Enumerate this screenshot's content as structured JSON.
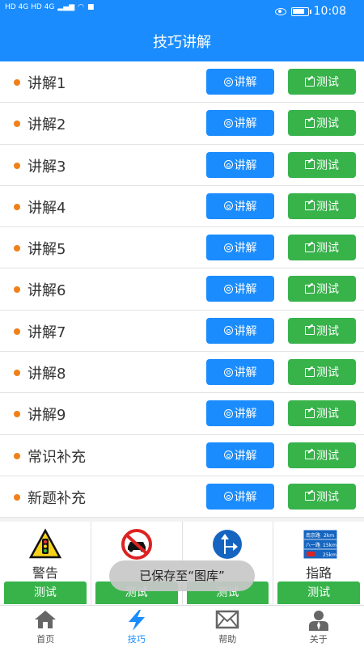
{
  "status_bar": {
    "left_text": "HD 4G HD 4G",
    "time": "10:08",
    "battery_level": 0.85
  },
  "header": {
    "title": "技巧讲解"
  },
  "list": {
    "explain_label": "讲解",
    "test_label": "测试",
    "items": [
      {
        "label": "讲解1"
      },
      {
        "label": "讲解2"
      },
      {
        "label": "讲解3"
      },
      {
        "label": "讲解4"
      },
      {
        "label": "讲解5"
      },
      {
        "label": "讲解6"
      },
      {
        "label": "讲解7"
      },
      {
        "label": "讲解8"
      },
      {
        "label": "讲解9"
      },
      {
        "label": "常识补充"
      },
      {
        "label": "新题补充"
      }
    ]
  },
  "signs": [
    {
      "label": "警告",
      "button": "测试",
      "icon": "warning-traffic-light-icon"
    },
    {
      "label": "",
      "button": "测试",
      "icon": "prohibition-no-car-icon"
    },
    {
      "label": "",
      "button": "测试",
      "icon": "mandatory-direction-icon"
    },
    {
      "label": "指路",
      "button": "测试",
      "icon": "guide-road-sign-icon"
    }
  ],
  "guide_sign_text": {
    "row1_name": "南京路",
    "row1_dist": "2km",
    "row2_name": "八一路",
    "row2_dist": "15km",
    "row3_dist": "25km"
  },
  "toast": {
    "text": "已保存至“图库”"
  },
  "tabbar": {
    "items": [
      {
        "label": "首页",
        "icon": "home-icon"
      },
      {
        "label": "技巧",
        "icon": "lightning-icon"
      },
      {
        "label": "帮助",
        "icon": "mail-icon"
      },
      {
        "label": "关于",
        "icon": "person-icon"
      }
    ],
    "active_index": 1
  },
  "colors": {
    "primary": "#1a8cfe",
    "green": "#37b34a",
    "dot": "#f08019"
  }
}
